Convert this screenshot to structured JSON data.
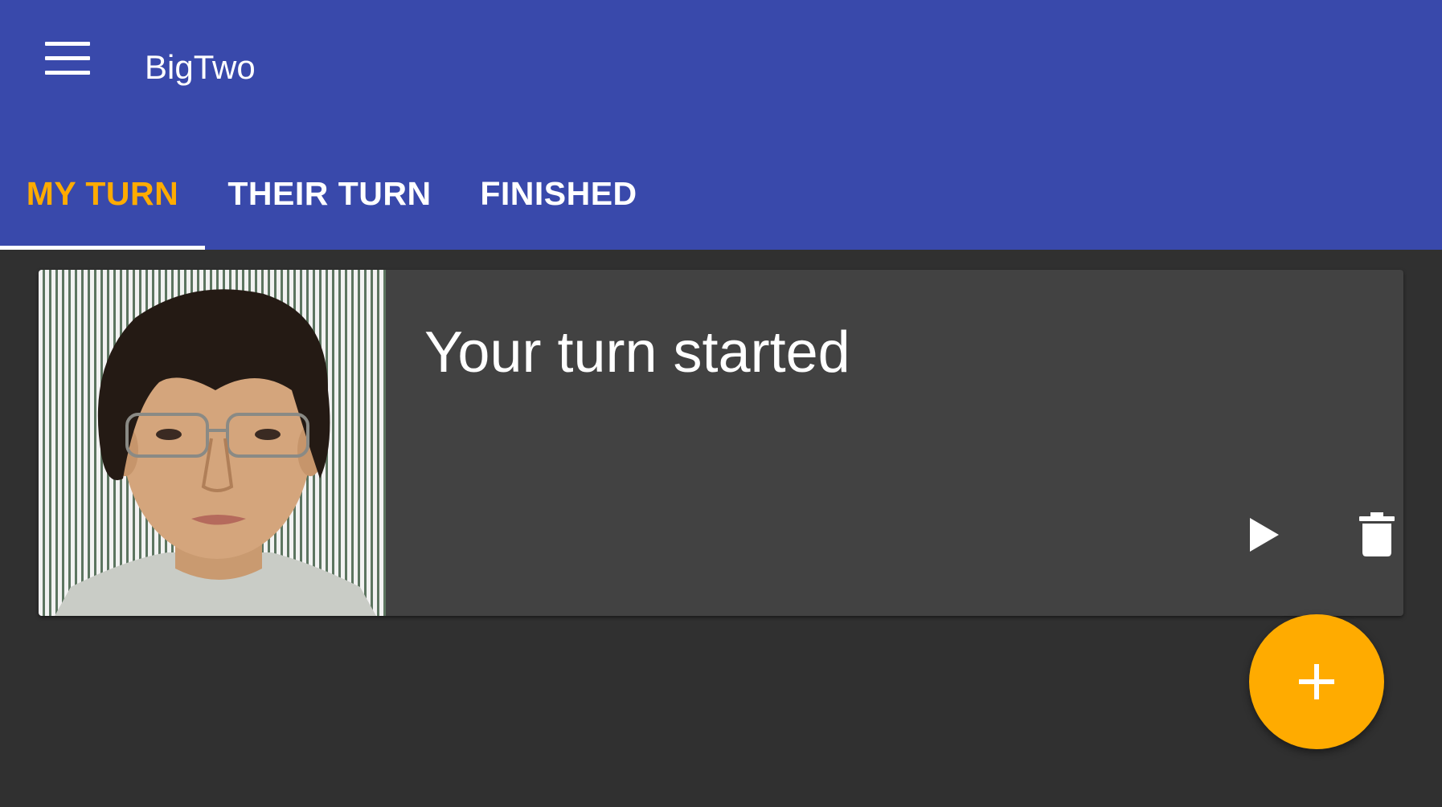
{
  "colors": {
    "appbar": "#3949ab",
    "accent": "#ffab00",
    "background": "#303030",
    "card": "#424242",
    "text": "#ffffff"
  },
  "appbar": {
    "menu_icon": "menu-icon",
    "title": "BigTwo"
  },
  "tabs": [
    {
      "label": "MY TURN",
      "active": true
    },
    {
      "label": "THEIR TURN",
      "active": false
    },
    {
      "label": "FINISHED",
      "active": false
    }
  ],
  "games": [
    {
      "status": "Your turn started",
      "avatar": "player-photo",
      "actions": {
        "play_icon": "play-icon",
        "delete_icon": "delete-icon"
      }
    }
  ],
  "fab": {
    "icon": "add-icon"
  }
}
